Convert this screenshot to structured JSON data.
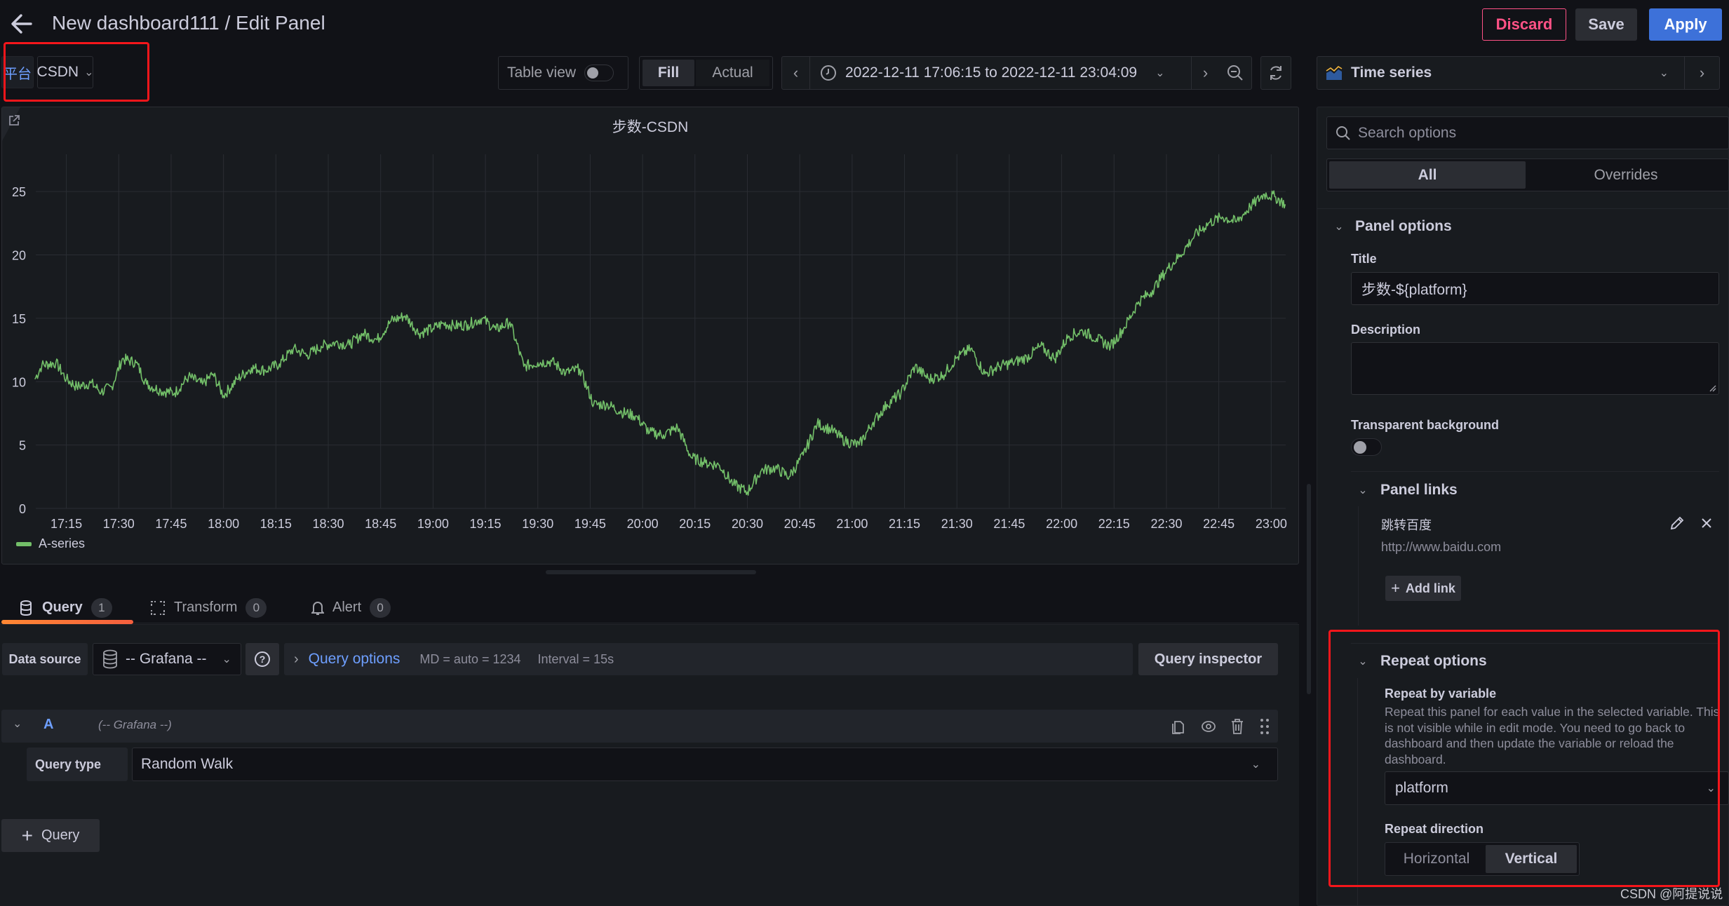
{
  "header": {
    "title": "New dashboard111 / Edit Panel",
    "discard_label": "Discard",
    "save_label": "Save",
    "apply_label": "Apply"
  },
  "variables": {
    "label": "平台",
    "value": "CSDN"
  },
  "toolbar": {
    "table_view_label": "Table view",
    "table_view_on": false,
    "fill_label": "Fill",
    "actual_label": "Actual",
    "time_range": "2022-12-11 17:06:15 to 2022-12-11 23:04:09"
  },
  "viz_picker": {
    "label": "Time series"
  },
  "options": {
    "search_placeholder": "Search options",
    "tabs": [
      "All",
      "Overrides"
    ],
    "active_tab": "All",
    "panel_options": {
      "section_label": "Panel options",
      "title_label": "Title",
      "title_value": "步数-${platform}",
      "description_label": "Description",
      "description_value": "",
      "transparent_label": "Transparent background",
      "transparent_on": false
    },
    "panel_links": {
      "section_label": "Panel links",
      "links": [
        {
          "title": "跳转百度",
          "url": "http://www.baidu.com"
        }
      ],
      "add_link_label": "Add link"
    },
    "repeat_options": {
      "section_label": "Repeat options",
      "repeat_by_label": "Repeat by variable",
      "repeat_by_description": "Repeat this panel for each value in the selected variable. This is not visible while in edit mode. You need to go back to dashboard and then update the variable or reload the dashboard.",
      "repeat_by_value": "platform",
      "direction_label": "Repeat direction",
      "direction_options": [
        "Horizontal",
        "Vertical"
      ],
      "direction_selected": "Vertical"
    }
  },
  "query_tabs": [
    {
      "label": "Query",
      "count": "1",
      "active": true
    },
    {
      "label": "Transform",
      "count": "0",
      "active": false
    },
    {
      "label": "Alert",
      "count": "0",
      "active": false
    }
  ],
  "query": {
    "datasource_label": "Data source",
    "datasource_value": "-- Grafana --",
    "query_options_label": "Query options",
    "md_text": "MD = auto = 1234",
    "interval_text": "Interval = 15s",
    "inspector_label": "Query inspector",
    "row_ref": "A",
    "row_ds": "(-- Grafana --)",
    "query_type_label": "Query type",
    "query_type_value": "Random Walk",
    "add_query_label": "Query"
  },
  "colors": {
    "series": "#73bf69",
    "apply": "#3d71d9",
    "discard": "#ff5286",
    "tab_underline": "#f55f3e",
    "link_blue": "#6e9fff",
    "annotation_frame": "#f5161b"
  },
  "watermark": "CSDN @阿提说说",
  "chart_data": {
    "type": "line",
    "title": "步数-CSDN",
    "xlabel": "",
    "ylabel": "",
    "ylim": [
      0,
      27.5
    ],
    "yticks": [
      0,
      5,
      10,
      15,
      20,
      25
    ],
    "xlim": [
      "17:06",
      "23:04"
    ],
    "xticks": [
      "17:15",
      "17:30",
      "17:45",
      "18:00",
      "18:15",
      "18:30",
      "18:45",
      "19:00",
      "19:15",
      "19:30",
      "19:45",
      "20:00",
      "20:15",
      "20:30",
      "20:45",
      "21:00",
      "21:15",
      "21:30",
      "21:45",
      "22:00",
      "22:15",
      "22:30",
      "22:45",
      "23:00"
    ],
    "grid": true,
    "legend": "bottom-left",
    "series": [
      {
        "name": "A-series",
        "x": [
          "17:06",
          "17:08",
          "17:12",
          "17:15",
          "17:18",
          "17:22",
          "17:25",
          "17:28",
          "17:31",
          "17:35",
          "17:38",
          "17:42",
          "17:46",
          "17:50",
          "17:54",
          "17:57",
          "18:00",
          "18:04",
          "18:08",
          "18:12",
          "18:16",
          "18:20",
          "18:24",
          "18:28",
          "18:32",
          "18:36",
          "18:40",
          "18:44",
          "18:48",
          "18:52",
          "18:56",
          "19:00",
          "19:03",
          "19:06",
          "19:10",
          "19:14",
          "19:18",
          "19:22",
          "19:26",
          "19:30",
          "19:34",
          "19:38",
          "19:42",
          "19:46",
          "19:50",
          "19:54",
          "19:58",
          "20:02",
          "20:06",
          "20:10",
          "20:14",
          "20:18",
          "20:22",
          "20:26",
          "20:30",
          "20:34",
          "20:38",
          "20:42",
          "20:46",
          "20:50",
          "20:54",
          "20:58",
          "21:02",
          "21:06",
          "21:10",
          "21:14",
          "21:18",
          "21:22",
          "21:26",
          "21:30",
          "21:34",
          "21:38",
          "21:42",
          "21:46",
          "21:50",
          "21:54",
          "21:58",
          "22:02",
          "22:06",
          "22:10",
          "22:14",
          "22:18",
          "22:22",
          "22:26",
          "22:30",
          "22:34",
          "22:38",
          "22:42",
          "22:46",
          "22:50",
          "22:54",
          "22:58",
          "23:01",
          "23:04"
        ],
        "y": [
          10.2,
          11.3,
          11.5,
          10.2,
          9.6,
          9.9,
          9.2,
          9.6,
          11.8,
          11.5,
          9.8,
          9.3,
          9.1,
          10.4,
          9.8,
          10.6,
          8.9,
          10.2,
          11.1,
          10.9,
          11.4,
          12.6,
          12.1,
          12.8,
          13.1,
          12.9,
          13.8,
          13.3,
          14.8,
          15.2,
          13.8,
          14.2,
          14.6,
          14.4,
          14.5,
          15.0,
          14.1,
          14.7,
          11.2,
          11.5,
          11.6,
          10.7,
          11.0,
          8.2,
          8.2,
          7.6,
          7.3,
          6.0,
          5.8,
          6.4,
          4.0,
          3.6,
          3.4,
          1.9,
          1.3,
          3.0,
          3.2,
          2.5,
          4.2,
          6.7,
          6.2,
          5.3,
          5.0,
          6.8,
          8.2,
          9.1,
          11.2,
          10.2,
          10.5,
          11.9,
          12.6,
          10.6,
          11.2,
          11.5,
          11.9,
          12.8,
          11.8,
          13.6,
          14.0,
          13.4,
          12.8,
          14.3,
          16.3,
          17.2,
          18.8,
          20.0,
          21.5,
          22.5,
          23.0,
          22.6,
          23.8,
          24.8,
          24.6,
          24.0
        ]
      }
    ]
  }
}
